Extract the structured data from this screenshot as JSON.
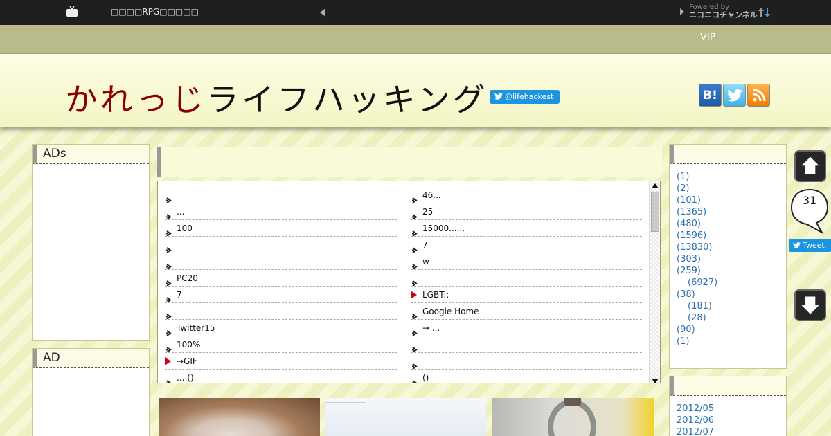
{
  "topbar": {
    "title": "□□□□RPG□□□□□",
    "powered_by": "Powered by",
    "powered_brand": "ニコニコチャンネル"
  },
  "nav": {
    "vip": "VIP"
  },
  "header": {
    "logo_red": "かれっじ",
    "logo_black": "ライフハッキング",
    "twitter_handle": "@lifehackest",
    "hatena_label": "B!"
  },
  "left": {
    "ad1_title": "ADs",
    "ad2_title": "AD"
  },
  "feed": {
    "col1": [
      {
        "text": "",
        "mark": "arrow"
      },
      {
        "text": "...",
        "mark": "arrow"
      },
      {
        "text": "100",
        "mark": "arrow"
      },
      {
        "text": "",
        "mark": "arrow"
      },
      {
        "text": "",
        "mark": "arrow"
      },
      {
        "text": "PC20",
        "mark": "arrow"
      },
      {
        "text": "7",
        "mark": "arrow"
      },
      {
        "text": "",
        "mark": "arrow"
      },
      {
        "text": "Twitter15",
        "mark": "arrow"
      },
      {
        "text": "100%",
        "mark": "arrow"
      },
      {
        "text": " →GIF",
        "mark": "red"
      },
      {
        "text": "... ()",
        "mark": "arrow"
      }
    ],
    "col2": [
      {
        "text": "46...",
        "mark": "arrow"
      },
      {
        "text": "25",
        "mark": "arrow"
      },
      {
        "text": " 15000......",
        "mark": "arrow"
      },
      {
        "text": "7",
        "mark": "arrow"
      },
      {
        "text": "w",
        "mark": "arrow"
      },
      {
        "text": "",
        "mark": "arrow"
      },
      {
        "text": "LGBT::",
        "mark": "red"
      },
      {
        "text": "Google Home",
        "mark": "arrow"
      },
      {
        "text": " → ...",
        "mark": "arrow"
      },
      {
        "text": "",
        "mark": "arrow"
      },
      {
        "text": "",
        "mark": "arrow"
      },
      {
        "text": "()",
        "mark": "arrow"
      }
    ]
  },
  "categories": [
    {
      "label": "(1)",
      "indent": false
    },
    {
      "label": "(2)",
      "indent": false
    },
    {
      "label": "(101)",
      "indent": false
    },
    {
      "label": "(1365)",
      "indent": false
    },
    {
      "label": "(480)",
      "indent": false
    },
    {
      "label": "(1596)",
      "indent": false
    },
    {
      "label": "(13830)",
      "indent": false
    },
    {
      "label": "(303)",
      "indent": false
    },
    {
      "label": "(259)",
      "indent": false
    },
    {
      "label": "(6927)",
      "indent": true
    },
    {
      "label": "(38)",
      "indent": false
    },
    {
      "label": "(181)",
      "indent": true
    },
    {
      "label": "(28)",
      "indent": true
    },
    {
      "label": "(90)",
      "indent": false
    },
    {
      "label": "(1)",
      "indent": false
    }
  ],
  "archives": [
    "2012/05",
    "2012/06",
    "2012/07"
  ],
  "floating": {
    "share_count": "31",
    "tweet_label": "Tweet"
  },
  "colors": {
    "accent_blue": "#1b95e0",
    "link_blue": "#2a6fb0",
    "marker_red": "#d0021b"
  }
}
